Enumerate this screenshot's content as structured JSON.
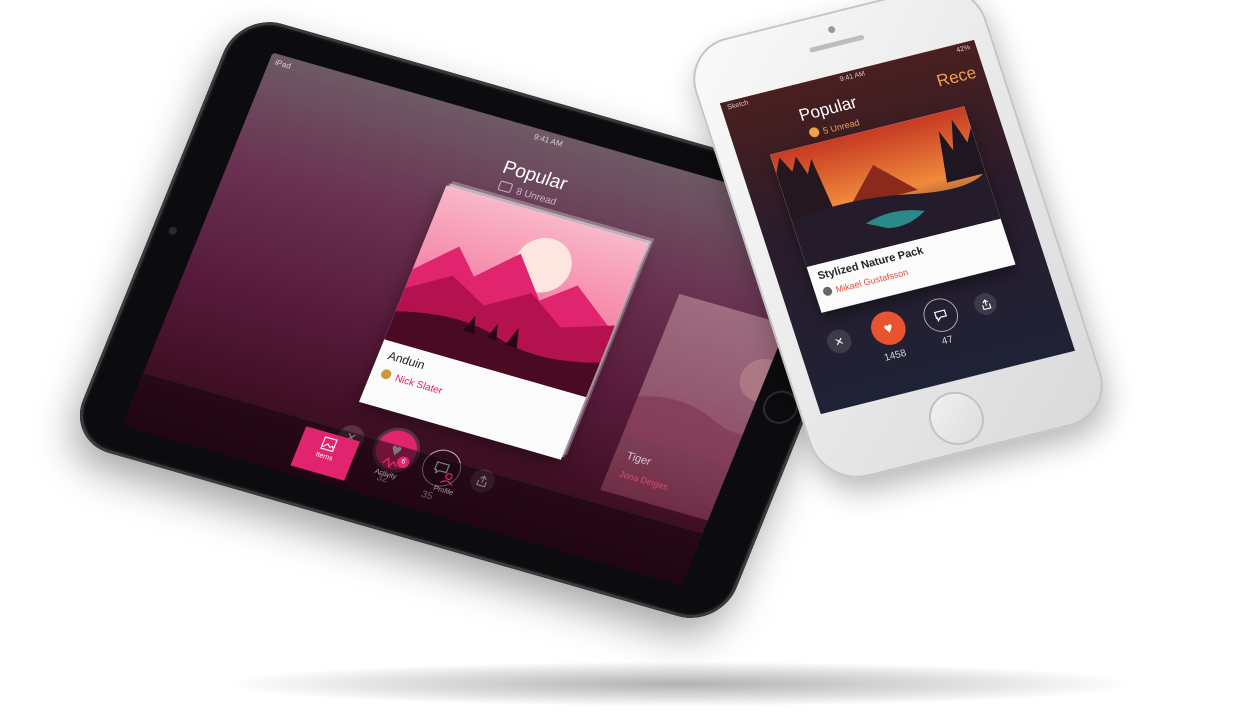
{
  "ipad": {
    "status_left": "iPad",
    "status_time": "9:41 AM",
    "title": "Popular",
    "unread": "8 Unread",
    "card": {
      "name": "Anduin",
      "author": "Nick Slater"
    },
    "side_card": {
      "name": "Tiger",
      "author": "Jona Dinges"
    },
    "counts": {
      "likes": "32",
      "comments": "35"
    },
    "tabs": [
      {
        "label": "Items"
      },
      {
        "label": "Activity",
        "badge": "6"
      },
      {
        "label": "Profile"
      }
    ],
    "colors": {
      "accent": "#e0246d"
    }
  },
  "iphone": {
    "status_left": "Sketch",
    "status_time": "9:41 AM",
    "status_right": "42%",
    "title": "Popular",
    "next_title": "Rece",
    "unread": "5 Unread",
    "card": {
      "name": "Stylized Nature Pack",
      "author": "Mikael Gustafsson"
    },
    "counts": {
      "likes": "1458",
      "comments": "47"
    },
    "colors": {
      "accent": "#e8542f"
    }
  }
}
